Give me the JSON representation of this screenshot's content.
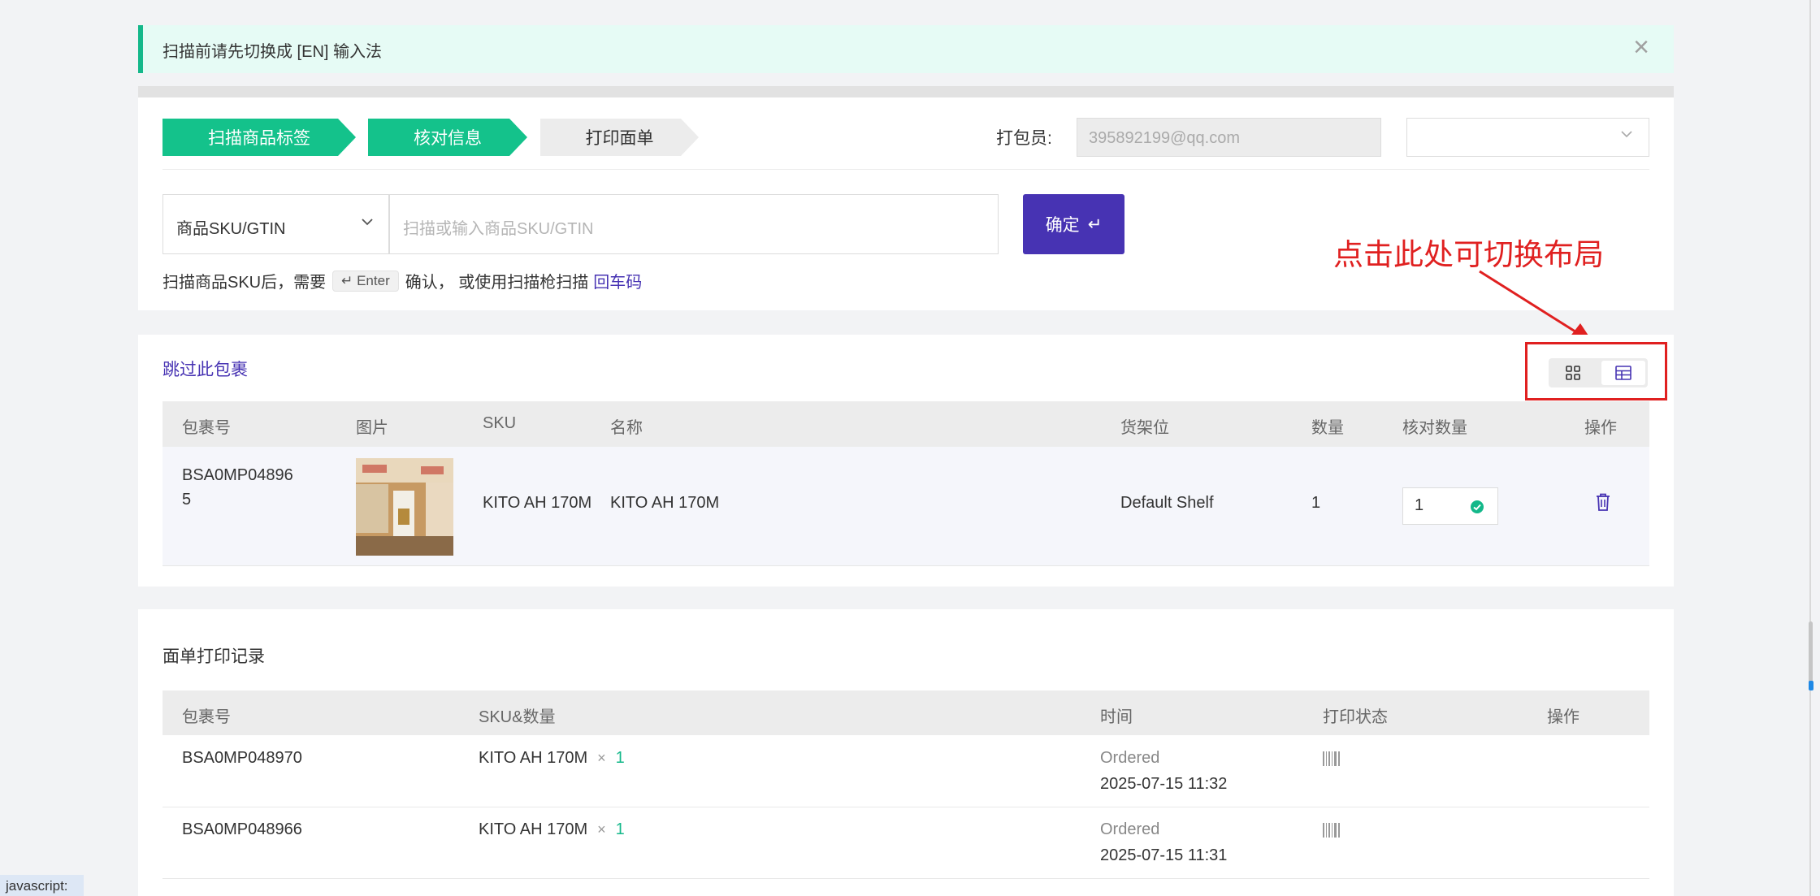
{
  "notice": {
    "text": "扫描前请先切换成 [EN] 输入法"
  },
  "steps": [
    "扫描商品标签",
    "核对信息",
    "打印面单"
  ],
  "packer": {
    "label": "打包员:",
    "value": "395892199@qq.com"
  },
  "scan": {
    "type_label": "商品SKU/GTIN",
    "placeholder": "扫描或输入商品SKU/GTIN",
    "confirm_label": "确定",
    "hint_prefix": "扫描商品SKU后，需要",
    "hint_key": "↵ Enter",
    "hint_mid": "确认，  或使用扫描枪扫描",
    "hint_link": "回车码"
  },
  "annotation": "点击此处可切换布局",
  "package": {
    "skip_label": "跳过此包裹",
    "columns": [
      "包裹号",
      "图片",
      "SKU",
      "名称",
      "货架位",
      "数量",
      "核对数量",
      "操作"
    ],
    "row": {
      "package_no_line1": "BSA0MP04896",
      "package_no_line2": "5",
      "sku": "KITO AH 170M",
      "name": "KITO AH 170M",
      "shelf": "Default Shelf",
      "qty": "1",
      "check_qty": "1"
    }
  },
  "records": {
    "title": "面单打印记录",
    "columns": [
      "包裹号",
      "SKU&数量",
      "时间",
      "打印状态",
      "操作"
    ],
    "rows": [
      {
        "package_no": "BSA0MP048970",
        "sku": "KITO AH 170M",
        "times": "×",
        "qty": "1",
        "status": "Ordered",
        "time": "2025-07-15 11:32"
      },
      {
        "package_no": "BSA0MP048966",
        "sku": "KITO AH 170M",
        "times": "×",
        "qty": "1",
        "status": "Ordered",
        "time": "2025-07-15 11:31"
      }
    ]
  },
  "status_bar": "javascript:",
  "colors": {
    "primary": "#4733b3",
    "step_active": "#14c28b",
    "annotation_red": "#e02020"
  }
}
